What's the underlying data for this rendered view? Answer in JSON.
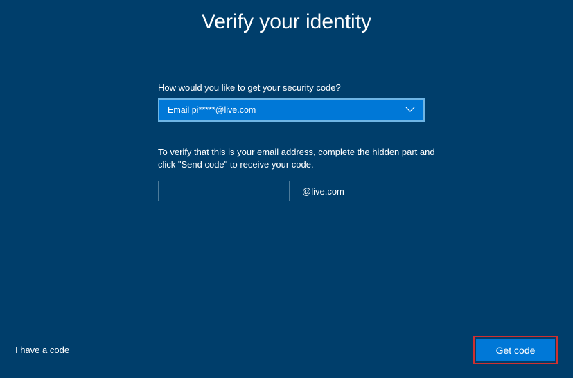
{
  "title": "Verify your identity",
  "securityPrompt": "How would you like to get your security code?",
  "selectedOption": "Email pi*****@live.com",
  "instruction": "To verify that this is your email address, complete the hidden part and click \"Send code\" to receive your code.",
  "emailSuffix": "@live.com",
  "emailInputValue": "",
  "haveCodeLink": "I have a code",
  "getCodeButton": "Get code"
}
